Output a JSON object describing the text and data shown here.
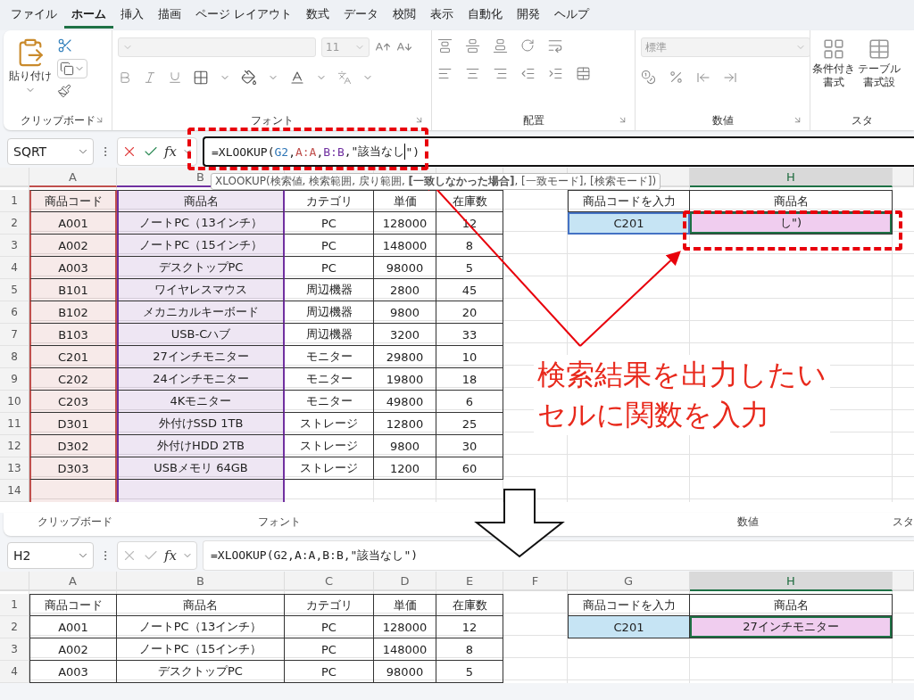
{
  "menu_tabs": [
    {
      "label": "ファイル",
      "selected": false
    },
    {
      "label": "ホーム",
      "selected": true
    },
    {
      "label": "挿入",
      "selected": false
    },
    {
      "label": "描画",
      "selected": false
    },
    {
      "label": "ページ レイアウト",
      "selected": false
    },
    {
      "label": "数式",
      "selected": false
    },
    {
      "label": "データ",
      "selected": false
    },
    {
      "label": "校閲",
      "selected": false
    },
    {
      "label": "表示",
      "selected": false
    },
    {
      "label": "自動化",
      "selected": false
    },
    {
      "label": "開発",
      "selected": false
    },
    {
      "label": "ヘルプ",
      "selected": false
    }
  ],
  "ribbon": {
    "paste": "貼り付け",
    "font_size": "11",
    "number_format": "標準",
    "styles_buttons": [
      [
        "条件付き",
        "書式"
      ],
      [
        "テーブル",
        "書式設"
      ]
    ],
    "group_labels": [
      "クリップボード",
      "フォント",
      "配置",
      "数値",
      "スタ"
    ]
  },
  "top_formula_bar": {
    "name_box": "SQRT",
    "function_label": "fx",
    "editing": true,
    "segments": [
      {
        "text": "=XLOOKUP(",
        "caret": false
      },
      {
        "text": "G2",
        "color": "#2e75b6",
        "caret": false
      },
      {
        "text": ",",
        "caret": false
      },
      {
        "text": "A:A",
        "color": "#c0504d",
        "caret": false
      },
      {
        "text": ",",
        "caret": false
      },
      {
        "text": "B:B",
        "color": "#7030a0",
        "caret": false
      },
      {
        "text": ",\"該当なし",
        "caret": true
      },
      {
        "text": "\")",
        "caret": false
      }
    ]
  },
  "tooltip": "XLOOKUP(検索値, 検索範囲, 戻り範囲, **[一致しなかった場合]**, [一致モード], [検索モード])",
  "top_sheet": {
    "columns": [
      {
        "letter": "A",
        "color": "#c0504d",
        "selected": false
      },
      {
        "letter": "B",
        "color": "#7030a0",
        "selected": false
      },
      {
        "selected": false
      },
      {
        "selected": false
      },
      {
        "selected": false
      },
      {
        "selected": false
      },
      {
        "selected": false
      },
      {
        "letter": "H",
        "selected": true
      }
    ],
    "row_numbers": [
      "1",
      "2",
      "3",
      "4",
      "5",
      "6",
      "7",
      "8",
      "9",
      "10",
      "11",
      "12",
      "13",
      "14"
    ],
    "table": [
      [
        "商品コード",
        "商品名",
        "カテゴリ",
        "単価",
        "在庫数"
      ],
      [
        "A001",
        "ノートPC（13インチ）",
        "PC",
        "128000",
        "12"
      ],
      [
        "A002",
        "ノートPC（15インチ）",
        "PC",
        "148000",
        "8"
      ],
      [
        "A003",
        "デスクトップPC",
        "PC",
        "98000",
        "5"
      ],
      [
        "B101",
        "ワイヤレスマウス",
        "周辺機器",
        "2800",
        "45"
      ],
      [
        "B102",
        "メカニカルキーボード",
        "周辺機器",
        "9800",
        "20"
      ],
      [
        "B103",
        "USB-Cハブ",
        "周辺機器",
        "3200",
        "33"
      ],
      [
        "C201",
        "27インチモニター",
        "モニター",
        "29800",
        "10"
      ],
      [
        "C202",
        "24インチモニター",
        "モニター",
        "19800",
        "18"
      ],
      [
        "C203",
        "4Kモニター",
        "モニター",
        "49800",
        "6"
      ],
      [
        "D301",
        "外付けSSD 1TB",
        "ストレージ",
        "12800",
        "25"
      ],
      [
        "D302",
        "外付けHDD 2TB",
        "ストレージ",
        "9800",
        "30"
      ],
      [
        "D303",
        "USBメモリ 64GB",
        "ストレージ",
        "1200",
        "60"
      ]
    ],
    "lookup": {
      "label": "商品コードを入力",
      "result_header": "商品名",
      "input": "C201",
      "result": "し\")",
      "input_ref": {
        "color": "#4472c4"
      }
    }
  },
  "bottom_ribbon_labels": [
    "クリップボード",
    "フォント",
    "数値",
    "スタ"
  ],
  "bottom_formula_bar": {
    "name_box": "H2",
    "function_label": "fx",
    "editing": false,
    "segments": [
      {
        "text": "=XLOOKUP(G2,A:A,B:B,\"該当なし\")",
        "caret": false
      }
    ]
  },
  "bottom_sheet": {
    "columns": [
      {
        "letter": "A",
        "selected": false
      },
      {
        "letter": "B",
        "selected": false
      },
      {
        "letter": "C",
        "selected": false
      },
      {
        "letter": "D",
        "selected": false
      },
      {
        "letter": "E",
        "selected": false
      },
      {
        "letter": "F",
        "selected": false
      },
      {
        "letter": "G",
        "selected": false
      },
      {
        "letter": "H",
        "selected": true
      }
    ],
    "row_numbers": [
      "1",
      "2",
      "3",
      "4"
    ],
    "table": [
      [
        "商品コード",
        "商品名",
        "カテゴリ",
        "単価",
        "在庫数"
      ],
      [
        "A001",
        "ノートPC（13インチ）",
        "PC",
        "128000",
        "12"
      ],
      [
        "A002",
        "ノートPC（15インチ）",
        "PC",
        "148000",
        "8"
      ],
      [
        "A003",
        "デスクトップPC",
        "PC",
        "98000",
        "5"
      ]
    ],
    "lookup": {
      "label": "商品コードを入力",
      "result_header": "商品名",
      "input": "C201",
      "result": "27インチモニター"
    }
  },
  "callout": [
    "検索結果を出力したい",
    "セルに関数を入力"
  ]
}
